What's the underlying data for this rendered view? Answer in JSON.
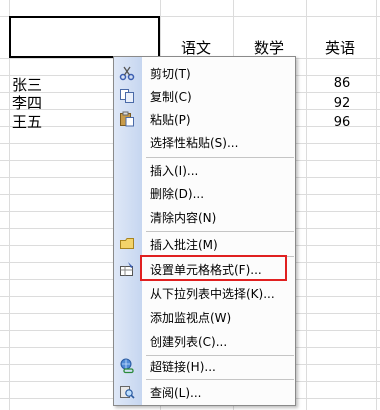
{
  "sheet": {
    "headers": [
      "语文",
      "数学",
      "英语"
    ],
    "names": [
      "张三",
      "李四",
      "王五"
    ],
    "english_scores": [
      "86",
      "92",
      "96"
    ]
  },
  "context_menu": {
    "items": [
      {
        "label": "剪切(T)",
        "icon": "scissors-icon"
      },
      {
        "label": "复制(C)",
        "icon": "copy-icon"
      },
      {
        "label": "粘贴(P)",
        "icon": "paste-icon"
      },
      {
        "label": "选择性粘贴(S)...",
        "icon": ""
      },
      {
        "label": "插入(I)...",
        "icon": ""
      },
      {
        "label": "删除(D)...",
        "icon": ""
      },
      {
        "label": "清除内容(N)",
        "icon": ""
      },
      {
        "label": "插入批注(M)",
        "icon": "comment-icon"
      },
      {
        "label": "设置单元格格式(F)...",
        "icon": "format-cells-icon"
      },
      {
        "label": "从下拉列表中选择(K)...",
        "icon": ""
      },
      {
        "label": "添加监视点(W)",
        "icon": ""
      },
      {
        "label": "创建列表(C)...",
        "icon": ""
      },
      {
        "label": "超链接(H)...",
        "icon": "hyperlink-icon"
      },
      {
        "label": "查阅(L)...",
        "icon": "research-icon"
      }
    ]
  },
  "colors": {
    "highlight_border": "#e02020",
    "gutter": "#c6d6f0"
  }
}
